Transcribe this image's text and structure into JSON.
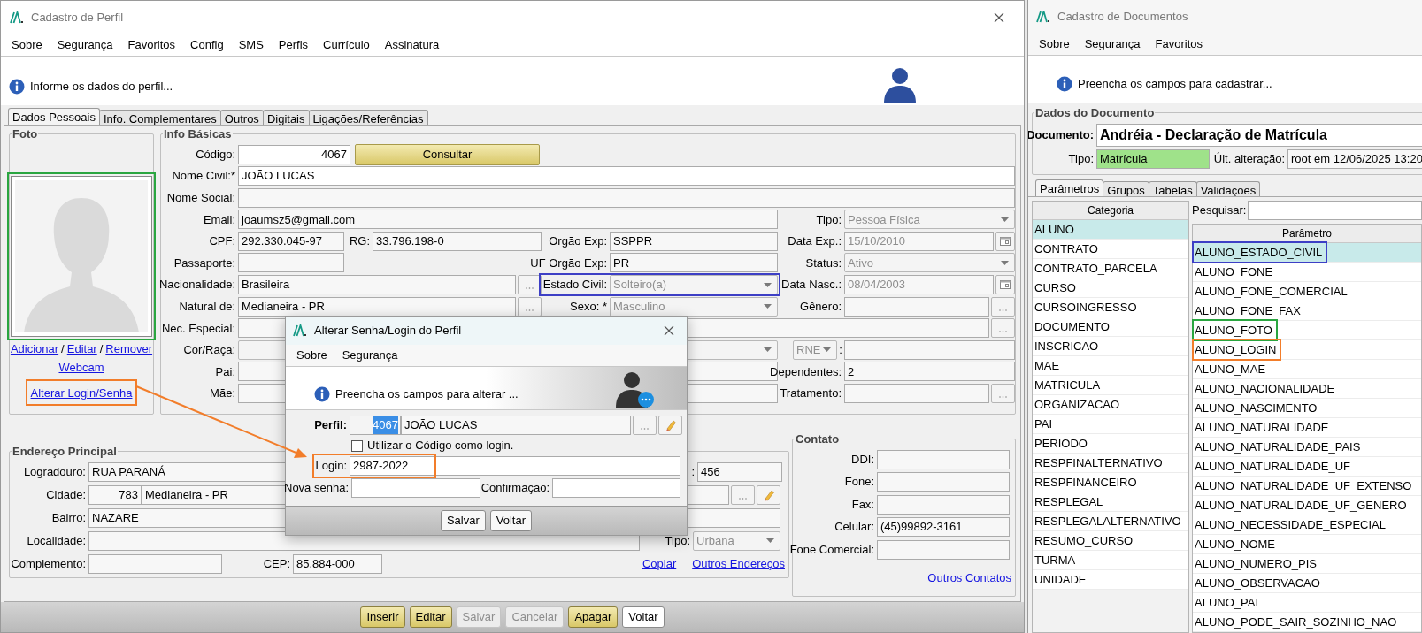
{
  "profile_window": {
    "title": "Cadastro de Perfil",
    "menu": [
      "Sobre",
      "Segurança",
      "Favoritos",
      "Config",
      "SMS",
      "Perfis",
      "Currículo",
      "Assinatura"
    ],
    "info": "Informe os dados do perfil...",
    "tabs": [
      {
        "label": "Dados Pessoais",
        "selected": true
      },
      {
        "label": "Info. Complementares",
        "selected": false
      },
      {
        "label": "Outros",
        "selected": false
      },
      {
        "label": "Digitais",
        "selected": false
      },
      {
        "label": "Ligações/Referências",
        "selected": false
      }
    ],
    "photo": {
      "title": "Foto",
      "color": "#2aa640",
      "links": [
        "Adicionar",
        "Editar",
        "Remover"
      ],
      "separators": [
        "/",
        "/"
      ],
      "webcam": "Webcam",
      "login_link": {
        "text": "Alterar Login/Senha",
        "color": "#f27d2a"
      }
    },
    "basic": {
      "title": "Info Básicas",
      "codigo": {
        "label": "Código:",
        "value": "4067"
      },
      "consultar": "Consultar",
      "nome_civil": {
        "label": "Nome Civil:*",
        "value": "JOÃO LUCAS"
      },
      "nome_social": {
        "label": "Nome Social:"
      },
      "email": {
        "label": "Email:",
        "value": "joaumsz5@gmail.com"
      },
      "tipo": {
        "label": "Tipo:",
        "value": "Pessoa Física",
        "disabled": true
      },
      "cpf": {
        "label": "CPF:",
        "value": "292.330.045-97"
      },
      "rg": {
        "label": "RG:",
        "value": "33.796.198-0"
      },
      "orgao_exp": {
        "label": "Orgão Exp:",
        "value": "SSPPR"
      },
      "data_exp": {
        "label": "Data Exp.:",
        "value": "15/10/2010",
        "disabled": true
      },
      "passaporte": {
        "label": "Passaporte:"
      },
      "uf_orgao_exp": {
        "label": "UF Orgão Exp:",
        "value": "PR"
      },
      "status": {
        "label": "Status:",
        "value": "Ativo",
        "disabled": true
      },
      "nacionalidade": {
        "label": "Nacionalidade:",
        "value": "Brasileira"
      },
      "estado_civil": {
        "label": "Estado Civil:",
        "value": "Solteiro(a)",
        "disabled": true,
        "color": "#3d3fc5"
      },
      "data_nasc": {
        "label": "Data Nasc.:",
        "value": "08/04/2003",
        "disabled": true
      },
      "natural_de": {
        "label": "Natural de:",
        "value": "Medianeira - PR"
      },
      "sexo": {
        "label": "Sexo: *",
        "value": "Masculino",
        "disabled": true
      },
      "genero": {
        "label": "Gênero:"
      },
      "nec_especial": {
        "label": "Nec. Especial:"
      },
      "cor_raca": {
        "label": "Cor/Raça:"
      },
      "doc_tipo": {
        "value": "RNE",
        "disabled": true
      },
      "doc_sep": ":",
      "pai": {
        "label": "Pai:"
      },
      "dependentes": {
        "label": "Dependentes:",
        "value": "2"
      },
      "mae": {
        "label": "Mãe:"
      },
      "tratamento": {
        "label": "Tratamento:"
      }
    },
    "address": {
      "title": "Endereço Principal",
      "logradouro": {
        "label": "Logradouro:",
        "value": "RUA PARANÁ"
      },
      "numero": {
        "label": ":",
        "value": "456"
      },
      "cidade": {
        "label": "Cidade:",
        "code": "783",
        "value": "Medianeira - PR"
      },
      "bairro": {
        "label": "Bairro:",
        "value": "NAZARE"
      },
      "localidade": {
        "label": "Localidade:"
      },
      "tipo": {
        "label": "Tipo:",
        "value": "Urbana",
        "disabled": true
      },
      "complemento": {
        "label": "Complemento:"
      },
      "cep": {
        "label": "CEP:",
        "value": "85.884-000"
      },
      "links": [
        "Copiar",
        "Outros Endereços"
      ]
    },
    "contact": {
      "title": "Contato",
      "fields": [
        {
          "label": "DDI:"
        },
        {
          "label": "Fone:"
        },
        {
          "label": "Fax:"
        },
        {
          "label": "Celular:",
          "value": "(45)99892-3161"
        },
        {
          "label": "Fone Comercial:"
        }
      ],
      "link": "Outros Contatos"
    },
    "buttons": [
      {
        "label": "Inserir",
        "kind": "action",
        "disabled": false
      },
      {
        "label": "Editar",
        "kind": "action",
        "disabled": false
      },
      {
        "label": "Salvar",
        "kind": "action",
        "disabled": true
      },
      {
        "label": "Cancelar",
        "kind": "action",
        "disabled": true
      },
      {
        "label": "Apagar",
        "kind": "action",
        "disabled": false
      },
      {
        "label": "Voltar",
        "kind": "plain",
        "disabled": false
      }
    ]
  },
  "dialog": {
    "title": "Alterar Senha/Login do Perfil",
    "menu": [
      "Sobre",
      "Segurança"
    ],
    "info": "Preencha os campos para alterar ...",
    "perfil": {
      "label": "Perfil:",
      "code": "4067",
      "code_highlighted": true,
      "value": "JOÃO LUCAS"
    },
    "checkbox": {
      "label": "Utilizar o Código como login.",
      "checked": false
    },
    "login": {
      "label": "Login:",
      "value": "2987-2022",
      "color": "#f27d2a"
    },
    "nova_senha": {
      "label": "Nova senha:"
    },
    "confirmacao": {
      "label": "Confirmação:"
    },
    "buttons": [
      "Salvar",
      "Voltar"
    ]
  },
  "documents_window": {
    "title": "Cadastro de Documentos",
    "menu": [
      "Sobre",
      "Segurança",
      "Favoritos"
    ],
    "info": "Preencha os campos para cadastrar...",
    "group_title": "Dados do Documento",
    "documento": {
      "label": "Documento:",
      "value": "Andréia - Declaração de Matrícula"
    },
    "tipo": {
      "label": "Tipo:",
      "value": "Matrícula"
    },
    "ultima": {
      "label": "Últ. alteração:",
      "value": "root em 12/06/2025 13:20"
    },
    "tabs": [
      {
        "label": "Parâmetros",
        "selected": true
      },
      {
        "label": "Grupos",
        "selected": false
      },
      {
        "label": "Tabelas",
        "selected": false
      },
      {
        "label": "Validações",
        "selected": false
      }
    ],
    "categories": {
      "header": "Categoria",
      "items": [
        {
          "text": "ALUNO",
          "selected": true
        },
        {
          "text": "CONTRATO",
          "selected": false
        },
        {
          "text": "CONTRATO_PARCELA",
          "selected": false
        },
        {
          "text": "CURSO",
          "selected": false
        },
        {
          "text": "CURSOINGRESSO",
          "selected": false
        },
        {
          "text": "DOCUMENTO",
          "selected": false
        },
        {
          "text": "INSCRICAO",
          "selected": false
        },
        {
          "text": "MAE",
          "selected": false
        },
        {
          "text": "MATRICULA",
          "selected": false
        },
        {
          "text": "ORGANIZACAO",
          "selected": false
        },
        {
          "text": "PAI",
          "selected": false
        },
        {
          "text": "PERIODO",
          "selected": false
        },
        {
          "text": "RESPFINALTERNATIVO",
          "selected": false
        },
        {
          "text": "RESPFINANCEIRO",
          "selected": false
        },
        {
          "text": "RESPLEGAL",
          "selected": false
        },
        {
          "text": "RESPLEGALALTERNATIVO",
          "selected": false
        },
        {
          "text": "RESUMO_CURSO",
          "selected": false
        },
        {
          "text": "TURMA",
          "selected": false
        },
        {
          "text": "UNIDADE",
          "selected": false
        }
      ]
    },
    "search": {
      "label": "Pesquisar:"
    },
    "parameters": {
      "header": "Parâmetro",
      "items": [
        {
          "text": "ALUNO_ESTADO_CIVIL",
          "selected": true,
          "color": "#3d3fc5"
        },
        {
          "text": "ALUNO_FONE",
          "selected": false
        },
        {
          "text": "ALUNO_FONE_COMERCIAL",
          "selected": false
        },
        {
          "text": "ALUNO_FONE_FAX",
          "selected": false
        },
        {
          "text": "ALUNO_FOTO",
          "selected": false,
          "color": "#2aa640"
        },
        {
          "text": "ALUNO_LOGIN",
          "selected": false,
          "color": "#f27d2a"
        },
        {
          "text": "ALUNO_MAE",
          "selected": false
        },
        {
          "text": "ALUNO_NACIONALIDADE",
          "selected": false
        },
        {
          "text": "ALUNO_NASCIMENTO",
          "selected": false
        },
        {
          "text": "ALUNO_NATURALIDADE",
          "selected": false
        },
        {
          "text": "ALUNO_NATURALIDADE_PAIS",
          "selected": false
        },
        {
          "text": "ALUNO_NATURALIDADE_UF",
          "selected": false
        },
        {
          "text": "ALUNO_NATURALIDADE_UF_EXTENSO",
          "selected": false
        },
        {
          "text": "ALUNO_NATURALIDADE_UF_GENERO",
          "selected": false
        },
        {
          "text": "ALUNO_NECESSIDADE_ESPECIAL",
          "selected": false
        },
        {
          "text": "ALUNO_NOME",
          "selected": false
        },
        {
          "text": "ALUNO_NUMERO_PIS",
          "selected": false
        },
        {
          "text": "ALUNO_OBSERVACAO",
          "selected": false
        },
        {
          "text": "ALUNO_PAI",
          "selected": false
        },
        {
          "text": "ALUNO_PODE_SAIR_SOZINHO_NAO",
          "selected": false
        }
      ]
    }
  }
}
